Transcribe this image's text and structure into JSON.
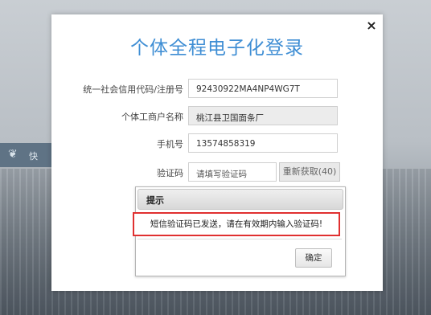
{
  "background": {
    "side_tab_icon": "leaf-icon",
    "side_tab_text": "快"
  },
  "dialog": {
    "title": "个体全程电子化登录",
    "close_symbol": "×",
    "fields": {
      "credit_code": {
        "label": "统一社会信用代码/注册号",
        "value": "92430922MA4NP4WG7T"
      },
      "business_name": {
        "label": "个体工商户名称",
        "value": "桃江县卫国面条厂"
      },
      "phone": {
        "label": "手机号",
        "value": "13574858319"
      },
      "verify_code": {
        "label": "验证码",
        "placeholder": "请填写验证码"
      }
    },
    "resend_button": "重新获取(40)"
  },
  "prompt": {
    "header": "提示",
    "message": "短信验证码已发送，请在有效期内输入验证码!",
    "ok_button": "确定"
  },
  "colors": {
    "title_blue": "#3f8ed4",
    "highlight_red": "#e03030"
  }
}
